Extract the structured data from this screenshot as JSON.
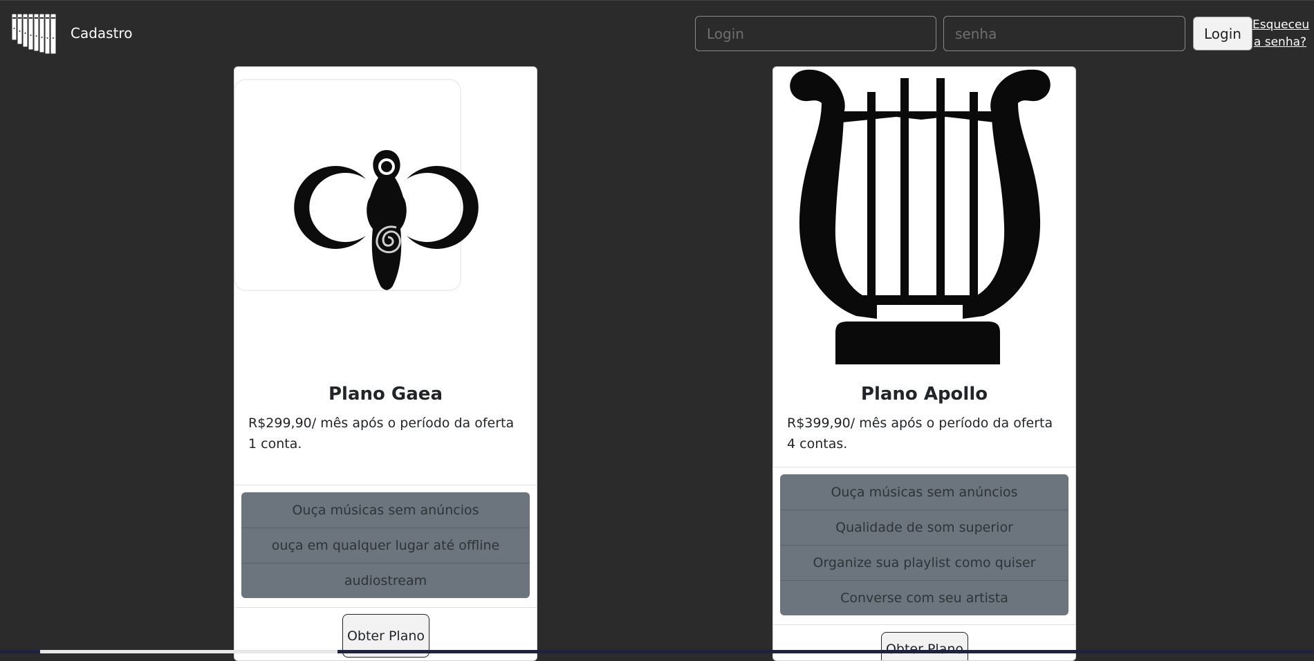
{
  "navbar": {
    "brand": "Cadastro",
    "login_placeholder": "Login",
    "password_placeholder": "senha",
    "login_button": "Login",
    "forgot_line1": "Esqueceu",
    "forgot_line2": "a senha?"
  },
  "plans": [
    {
      "title": "Plano Gaea",
      "description": "R$299,90/ mês após o período da oferta 1 conta.",
      "features": [
        "Ouça músicas sem anúncios",
        "ouça em qualquer lugar até offline",
        "audiostream"
      ],
      "button": "Obter Plano"
    },
    {
      "title": "Plano Apollo",
      "description": "R$399,90/ mês após o período da oferta 4 contas.",
      "features": [
        "Ouça músicas sem anúncios",
        "Qualidade de som superior",
        "Organize sua playlist como quiser",
        "Converse com seu artista"
      ],
      "button": "Obter Plano"
    }
  ],
  "colors": {
    "page_background": "#2b2b2b",
    "feature_background": "#6c757d"
  },
  "icons": [
    "kalimba-logo-icon",
    "goddess-moon-icon",
    "lyre-icon"
  ]
}
